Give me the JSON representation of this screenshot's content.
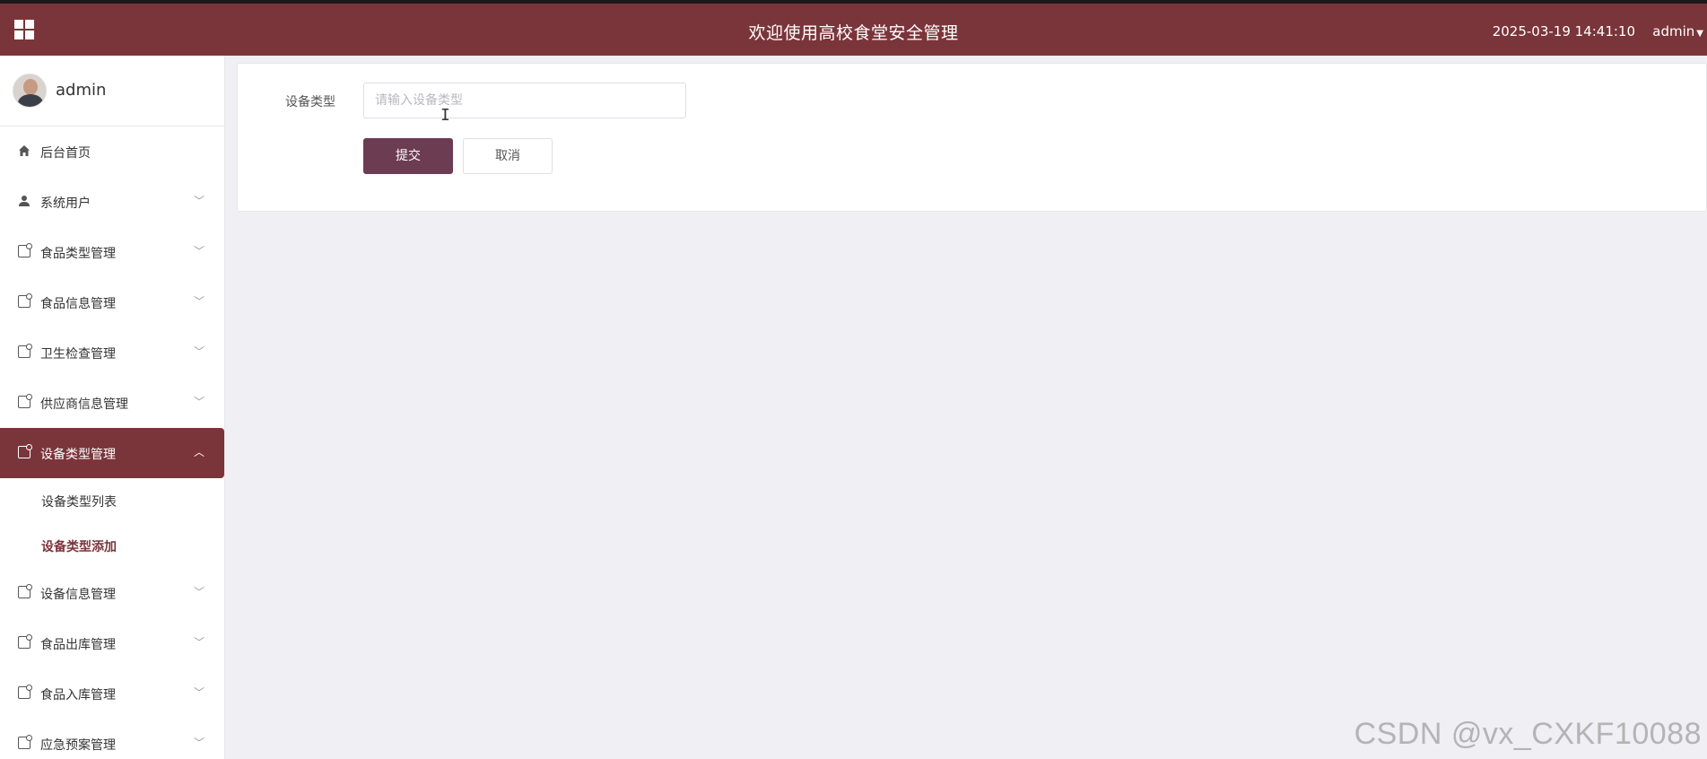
{
  "header": {
    "title": "欢迎使用高校食堂安全管理",
    "datetime": "2025-03-19 14:41:10",
    "user": "admin",
    "menu_icon": "grid-icon",
    "user_chevron": "chevron-down-icon",
    "bg_color": "#7a353a"
  },
  "sidebar": {
    "profile_name": "admin",
    "items": [
      {
        "label": "后台首页",
        "icon": "home-icon",
        "has_arrow": false
      },
      {
        "label": "系统用户",
        "icon": "user-icon",
        "has_arrow": true
      },
      {
        "label": "食品类型管理",
        "icon": "doc-icon",
        "has_arrow": true
      },
      {
        "label": "食品信息管理",
        "icon": "doc-icon",
        "has_arrow": true
      },
      {
        "label": "卫生检查管理",
        "icon": "doc-icon",
        "has_arrow": true
      },
      {
        "label": "供应商信息管理",
        "icon": "doc-icon",
        "has_arrow": true
      },
      {
        "label": "设备类型管理",
        "icon": "doc-icon",
        "has_arrow": true,
        "active": true,
        "children": [
          {
            "label": "设备类型列表"
          },
          {
            "label": "设备类型添加",
            "selected": true
          }
        ]
      },
      {
        "label": "设备信息管理",
        "icon": "doc-icon",
        "has_arrow": true
      },
      {
        "label": "食品出库管理",
        "icon": "doc-icon",
        "has_arrow": true
      },
      {
        "label": "食品入库管理",
        "icon": "doc-icon",
        "has_arrow": true
      },
      {
        "label": "应急预案管理",
        "icon": "doc-icon",
        "has_arrow": true
      }
    ],
    "arrow_down": "⌄",
    "arrow_up": "⌃"
  },
  "form": {
    "field_label": "设备类型",
    "field_value": "",
    "field_placeholder": "请输入设备类型",
    "submit_label": "提交",
    "cancel_label": "取消",
    "accent_color": "#6b3c52"
  },
  "watermark": "CSDN @vx_CXKF10088"
}
